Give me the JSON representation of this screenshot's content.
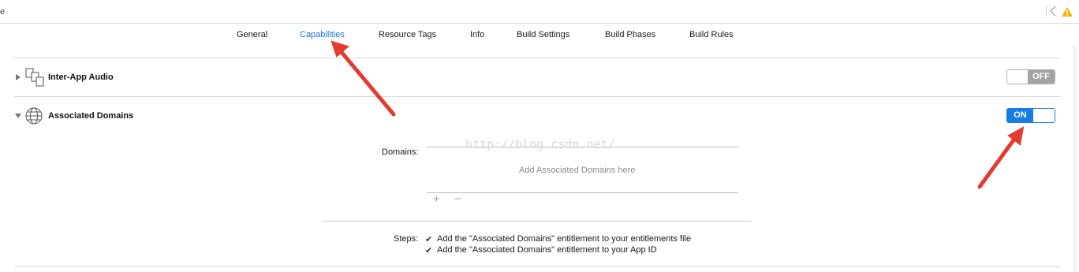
{
  "topbar": {
    "left_fragment": "e"
  },
  "tabs": [
    {
      "label": "General",
      "active": false
    },
    {
      "label": "Capabilities",
      "active": true
    },
    {
      "label": "Resource Tags",
      "active": false
    },
    {
      "label": "Info",
      "active": false
    },
    {
      "label": "Build Settings",
      "active": false
    },
    {
      "label": "Build Phases",
      "active": false
    },
    {
      "label": "Build Rules",
      "active": false
    }
  ],
  "capabilities": [
    {
      "title": "Inter-App Audio",
      "icon": "inter-app-audio-icon",
      "expanded": false,
      "switch_label": "OFF",
      "enabled": false
    },
    {
      "title": "Associated Domains",
      "icon": "globe-icon",
      "expanded": true,
      "switch_label": "ON",
      "enabled": true
    }
  ],
  "associated_domains": {
    "domains_label": "Domains:",
    "placeholder": "Add Associated Domains here",
    "add_glyph": "+",
    "remove_glyph": "−",
    "steps_label": "Steps:",
    "steps": [
      "Add the \"Associated Domains\" entitlement to your entitlements file",
      "Add the \"Associated Domains\" entitlement to your App ID"
    ],
    "check_glyph": "✔"
  },
  "watermark": "http://blog.csdn.net/",
  "colors": {
    "accent": "#1a7ae6",
    "arrow": "#e53a2f",
    "switch_off": "#a3a3a3"
  }
}
